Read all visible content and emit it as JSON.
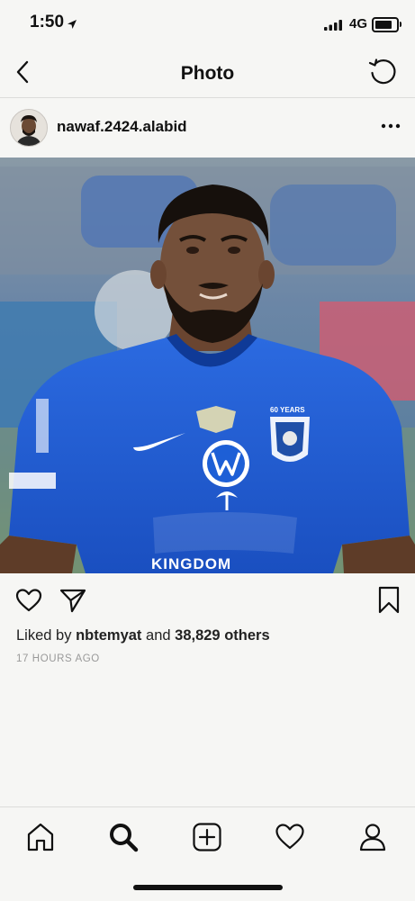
{
  "status_bar": {
    "time": "1:50",
    "network": "4G"
  },
  "header": {
    "title": "Photo"
  },
  "post": {
    "username": "nawaf.2424.alabid",
    "liked_by_prefix": "Liked by",
    "liked_by_user": "nbtemyat",
    "liked_by_joiner": "and",
    "liked_by_others": "38,829 others",
    "time_ago": "17 HOURS AGO",
    "jersey_text": {
      "badge": "60 YEARS",
      "sponsor": "KINGDOM"
    }
  },
  "tabs": [
    "home",
    "search",
    "new-post",
    "activity",
    "profile"
  ],
  "colors": {
    "jersey_blue": "#1d5fd6",
    "text_primary": "#111111",
    "text_muted": "#999999",
    "background": "#f6f6f4"
  },
  "icons": {
    "back": "chevron-left-icon",
    "refresh": "refresh-icon",
    "more": "more-dots-icon",
    "like": "heart-icon",
    "share": "paper-plane-icon",
    "save": "bookmark-icon"
  }
}
